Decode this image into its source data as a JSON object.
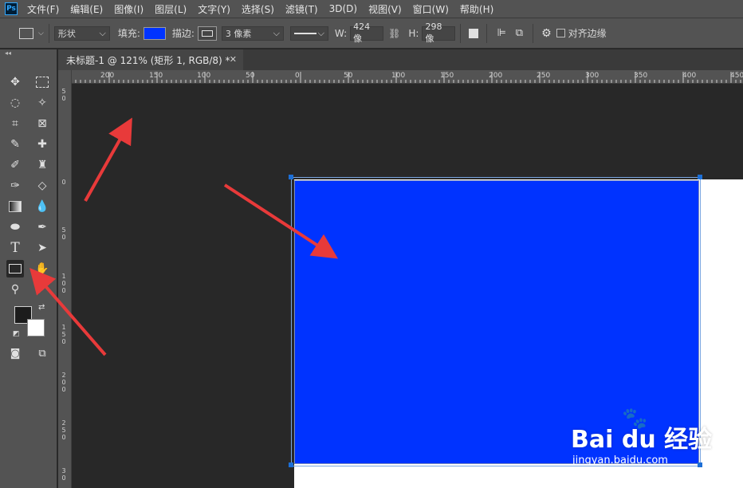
{
  "app": {
    "logo_text": "Ps"
  },
  "menu": [
    "文件(F)",
    "编辑(E)",
    "图像(I)",
    "图层(L)",
    "文字(Y)",
    "选择(S)",
    "滤镜(T)",
    "3D(D)",
    "视图(V)",
    "窗口(W)",
    "帮助(H)"
  ],
  "options": {
    "mode_value": "形状",
    "fill_label": "填充:",
    "fill_color": "#0033ff",
    "stroke_label": "描边:",
    "stroke_width_value": "3 像素",
    "w_label": "W:",
    "w_value": "424 像",
    "h_label": "H:",
    "h_value": "298 像",
    "align_edges_label": "对齐边缘"
  },
  "document": {
    "tab_title": "未标题-1 @ 121% (矩形 1, RGB/8) *",
    "shape_color": "#0033ff"
  },
  "ruler": {
    "top_labels": [
      "200",
      "150",
      "100",
      "50",
      "0",
      "50",
      "100",
      "150",
      "200",
      "250",
      "300",
      "350",
      "400",
      "450"
    ],
    "left_labels": [
      "5 0",
      "0",
      "5 0",
      "1 0 0",
      "1 5 0",
      "2 0 0",
      "2 5 0",
      "3 0"
    ]
  },
  "watermark": {
    "brand": "Bai du 经验",
    "url": "jingyan.baidu.com"
  },
  "colors": {
    "accent": "#0033ff",
    "annotation": "#e83a3a",
    "ui_bg": "#535353",
    "canvas_bg": "#282828"
  }
}
